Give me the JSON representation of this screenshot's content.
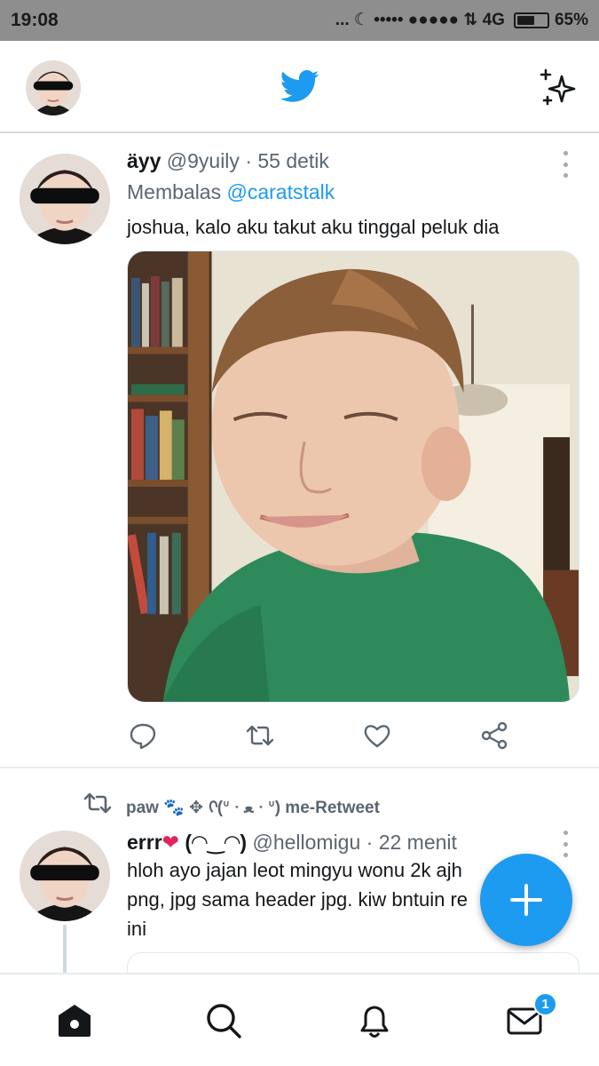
{
  "status_bar": {
    "time": "19:08",
    "right_text": "... ☾ ••••• ●●●●● ⇅ 4G",
    "battery": "65%",
    "battery_level": 0.65
  },
  "top_bar": {
    "logo_icon": "twitter-bird-icon",
    "right_icon": "sparkle-icon",
    "brand_color": "#1d9bf0"
  },
  "tweets": [
    {
      "display_name": "äyy",
      "handle": "@9yuily",
      "time": "· 55 detik",
      "reply_label": "Membalas",
      "reply_to": "@caratstalk",
      "text": "joshua, kalo aku takut aku tinggal peluk dia",
      "media": "photo"
    },
    {
      "retweeted_by": "paw 🐾 ✥ ᢉ(ᐡ ᐧ ﻌ ᐧ ᐡ) me-Retweet",
      "display_name": "errr",
      "name_suffix": "(◠‿◠)",
      "handle": "@hellomigu",
      "time": "· 22 menit",
      "text_lines": [
        "hloh ayo jajan leot mingyu wonu 2k ajh",
        "png, jpg sama header jpg. kiw bntuin re",
        "ini"
      ]
    }
  ],
  "actions": [
    "reply-icon",
    "retweet-icon",
    "like-icon",
    "share-icon"
  ],
  "bottom_nav": {
    "items": [
      "home-icon",
      "search-icon",
      "notifications-icon",
      "messages-icon"
    ],
    "messages_badge": "1"
  }
}
